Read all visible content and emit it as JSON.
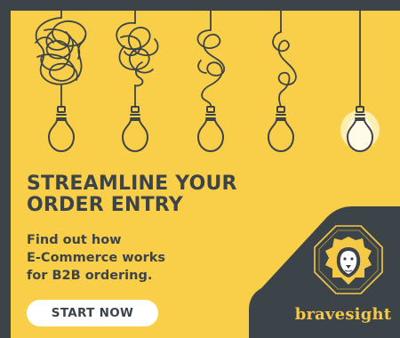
{
  "ad": {
    "headline": [
      "STREAMLINE YOUR",
      "ORDER ENTRY"
    ],
    "subtext": [
      "Find out how",
      "E-Commerce works",
      "for B2B ordering."
    ],
    "cta_label": "START NOW",
    "brand_name": "bravesight",
    "logo_icon": "lion-head-icon",
    "bulb_icon": "light-bulb-icon",
    "bulb_count": 5
  },
  "colors": {
    "background": "#f9cf4a",
    "frame": "#3d4449",
    "text": "#3d4449",
    "button": "#ffffff",
    "brand_accent": "#f5c945",
    "glow": "#fff8d6"
  }
}
